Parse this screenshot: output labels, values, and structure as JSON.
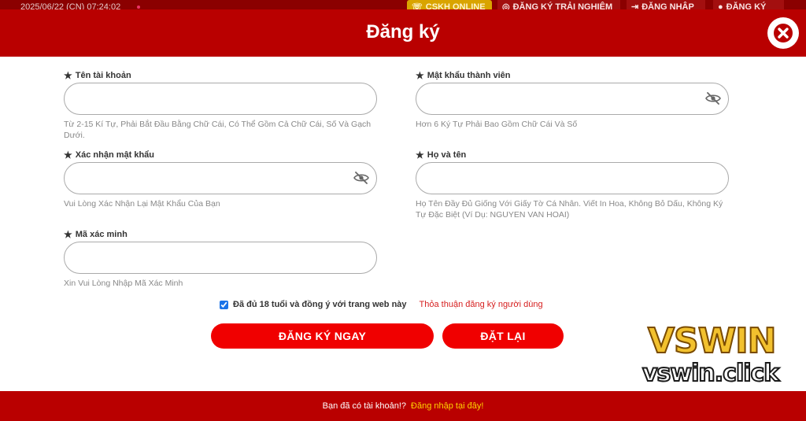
{
  "topbar": {
    "datetime": "2025/06/22 (CN) 07:24:02",
    "cskh_label": "CSKH ONLINE",
    "trial_label": "ĐĂNG KÝ TRẢI NGHIỆM",
    "login_label": "ĐĂNG NHẬP",
    "register_label": "ĐĂNG KÝ"
  },
  "modal": {
    "title": "Đăng ký"
  },
  "fields": {
    "username": {
      "label": "Tên tài khoản",
      "value": "",
      "hint": "Từ 2-15 Kí Tự, Phải Bắt Đầu Bằng Chữ Cái, Có Thể Gồm Cả Chữ Cái, Số Và Gạch Dưới."
    },
    "password": {
      "label": "Mật khẩu thành viên",
      "value": "",
      "hint": "Hơn 6 Ký Tự Phải Bao Gồm Chữ Cái Và Số"
    },
    "confirm_password": {
      "label": "Xác nhận mật khẩu",
      "value": "",
      "hint": "Vui Lòng Xác Nhận Lại Mật Khẩu Của Bạn"
    },
    "fullname": {
      "label": "Họ và tên",
      "value": "",
      "hint": "Họ Tên Đầy Đủ Giống Với Giấy Tờ Cá Nhân. Viết In Hoa, Không Bỏ Dấu, Không Ký Tự Đặc Biệt (Ví Dụ: NGUYEN VAN HOAI)"
    },
    "captcha": {
      "label": "Mã xác minh",
      "value": "",
      "hint": "Xin Vui Lòng Nhập Mã Xác Minh"
    }
  },
  "agreement": {
    "checked": true,
    "text": "Đã đủ 18 tuổi và đồng ý với trang web này",
    "link": "Thỏa thuận đăng ký người dùng"
  },
  "buttons": {
    "register": "ĐĂNG KÝ NGAY",
    "reset": "ĐẶT LẠI"
  },
  "watermark": {
    "logo": "VSWIN",
    "url": "vswin.click"
  },
  "footer": {
    "question": "Bạn đã có tài khoản!?",
    "login_link": "Đăng nhập tại đây!"
  },
  "icons": {
    "field": "star-icon",
    "password_toggle": "eye-slash-icon",
    "close": "close-icon"
  },
  "colors": {
    "brand_red": "#b90000",
    "button_red": "#f00000",
    "accent_yellow": "#ffd400"
  }
}
